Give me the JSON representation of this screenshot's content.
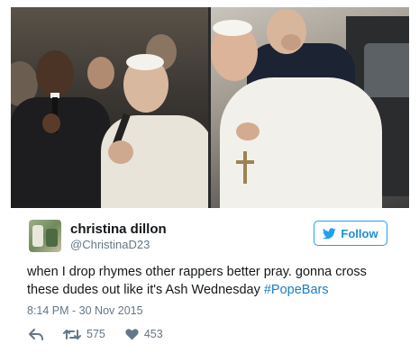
{
  "user": {
    "display_name": "christina dillon",
    "handle": "@ChristinaD23"
  },
  "follow_button": {
    "label": "Follow"
  },
  "tweet": {
    "text_line1": "when I drop rhymes other rappers better pray. gonna cross",
    "text_line2": "these dudes out like it's Ash Wednesday ",
    "hashtag": "#PopeBars",
    "timestamp": "8:14 PM - 30 Nov 2015"
  },
  "stats": {
    "retweets": "575",
    "likes": "453"
  },
  "icons": {
    "reply": "reply-icon",
    "retweet": "retweet-icon",
    "like": "heart-icon",
    "follow": "twitter-bird-icon"
  },
  "colors": {
    "accent": "#1da1f2",
    "hashtag": "#1b7ec2",
    "muted": "#657786",
    "text": "#14171a"
  }
}
